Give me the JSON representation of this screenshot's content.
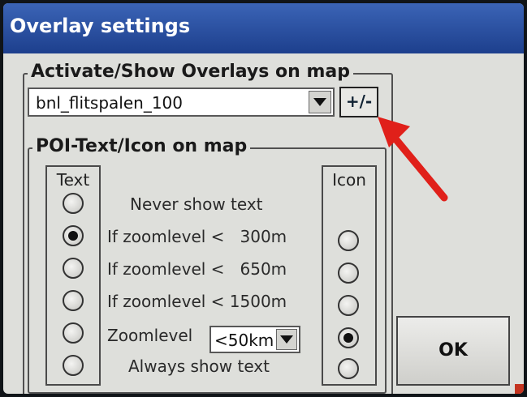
{
  "window": {
    "title": "Overlay settings"
  },
  "overlays_group": {
    "legend": "Activate/Show Overlays on map"
  },
  "overlay_select": {
    "value": "bnl_flitspalen_100"
  },
  "plus_minus_button": {
    "label": "+/-"
  },
  "poi_group": {
    "legend": "POI-Text/Icon on map"
  },
  "columns": {
    "text_header": "Text",
    "icon_header": "Icon"
  },
  "options": [
    {
      "label": "Never show text",
      "text_checked": false,
      "icon_checked": null
    },
    {
      "label": "If zoomlevel <   300m",
      "text_checked": true,
      "icon_checked": false
    },
    {
      "label": "If zoomlevel <   650m",
      "text_checked": false,
      "icon_checked": false
    },
    {
      "label": "If zoomlevel < 1500m",
      "text_checked": false,
      "icon_checked": false
    },
    {
      "label": "Zoomlevel",
      "text_checked": false,
      "icon_checked": true
    },
    {
      "label": "Always show text",
      "text_checked": false,
      "icon_checked": false
    }
  ],
  "zoom_select": {
    "value": "<50km"
  },
  "ok_button": {
    "label": "OK"
  },
  "colors": {
    "titlebar": "#1d3f8d",
    "annotation_arrow": "#e0201a"
  }
}
